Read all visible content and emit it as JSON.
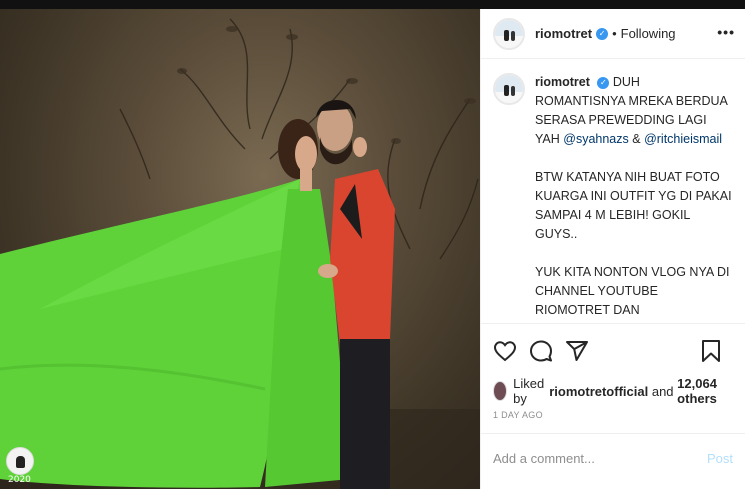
{
  "photo": {
    "watermark_year": "2020"
  },
  "header": {
    "username": "riomotret",
    "separator": "•",
    "follow_state": "Following",
    "more": "•••"
  },
  "caption": {
    "username": "riomotret",
    "line1_text": "DUH ROMANTISNYA MREKA BERDUA SERASA PREWEDDING LAGI YAH",
    "mention1": "@syahnazs",
    "amp": "&",
    "mention2": "@ritchieismail",
    "para2": "BTW KATANYA NIH BUAT FOTO KUARGA INI OUTFIT YG DI PAKAI SAMPAI 4 M LEBIH! GOKIL GUYS..",
    "para3": "YUK KITA NONTON VLOG NYA DI CHANNEL YOUTUBE RIOMOTRET DAN"
  },
  "likes": {
    "prefix": "Liked by",
    "user": "riomotretofficial",
    "and": "and",
    "count_text": "12,064 others"
  },
  "timestamp": "1 DAY AGO",
  "comment": {
    "placeholder": "Add a comment...",
    "post_label": "Post"
  },
  "colors": {
    "verified": "#3897f0",
    "mention": "#00376b",
    "post_disabled": "#b2dffc",
    "dress": "#5fd23a"
  },
  "icons": [
    "verified-badge-icon",
    "more-options-icon",
    "heart-icon",
    "comment-icon",
    "share-icon",
    "bookmark-icon"
  ]
}
